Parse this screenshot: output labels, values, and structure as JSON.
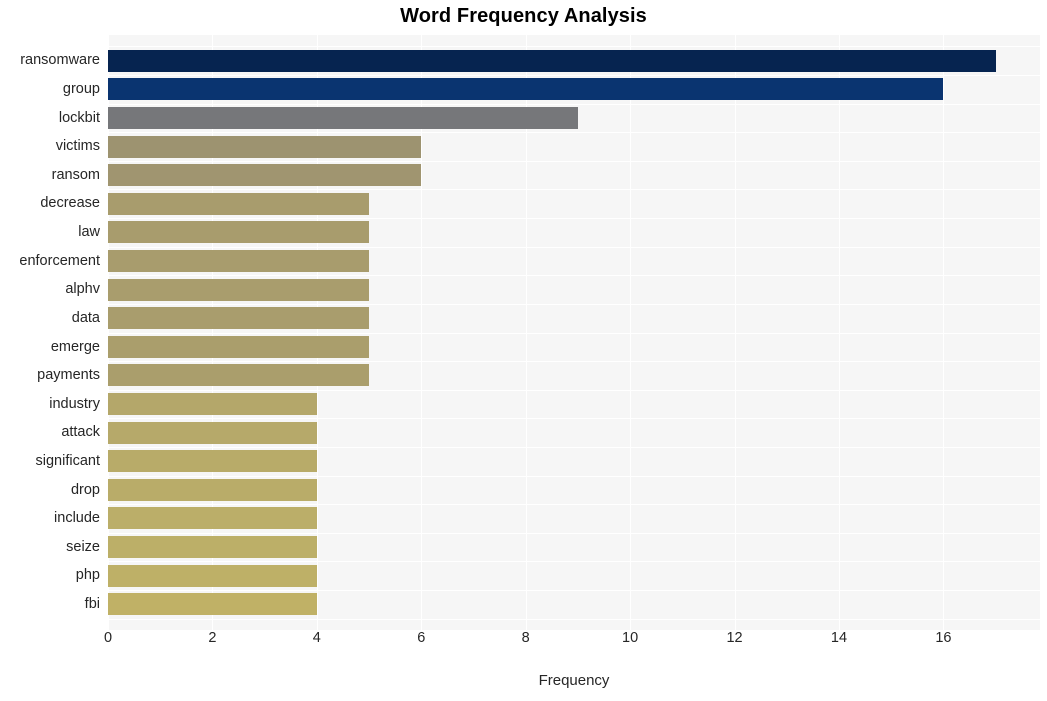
{
  "chart_data": {
    "type": "bar",
    "orientation": "horizontal",
    "title": "Word Frequency Analysis",
    "xlabel": "Frequency",
    "ylabel": "",
    "xlim": [
      0,
      17.85
    ],
    "xticks": [
      0,
      2,
      4,
      6,
      8,
      10,
      12,
      14,
      16
    ],
    "xtick_labels": [
      "0",
      "2",
      "4",
      "6",
      "8",
      "10",
      "12",
      "14",
      "16"
    ],
    "grid": true,
    "legend": null,
    "categories": [
      "ransomware",
      "group",
      "lockbit",
      "victims",
      "ransom",
      "decrease",
      "law",
      "enforcement",
      "alphv",
      "data",
      "emerge",
      "payments",
      "industry",
      "attack",
      "significant",
      "drop",
      "include",
      "seize",
      "php",
      "fbi"
    ],
    "values": [
      17,
      16,
      9,
      6,
      6,
      5,
      5,
      5,
      5,
      5,
      5,
      5,
      4,
      4,
      4,
      4,
      4,
      4,
      4,
      4
    ],
    "bar_colors": [
      "#062450",
      "#0a3470",
      "#76777a",
      "#9d9370",
      "#a09570",
      "#a89c6d",
      "#a89c6d",
      "#a89c6d",
      "#a99d6d",
      "#a99d6d",
      "#aa9e6c",
      "#aa9e6c",
      "#b4a76a",
      "#b6a96a",
      "#b8ab69",
      "#b9ac69",
      "#bbae69",
      "#bcaf68",
      "#beb067",
      "#c0b166"
    ],
    "plot_background": "#f6f6f6",
    "gridline_color": "#ffffff",
    "title_color": "#000000",
    "tick_label_color": "#262626"
  }
}
